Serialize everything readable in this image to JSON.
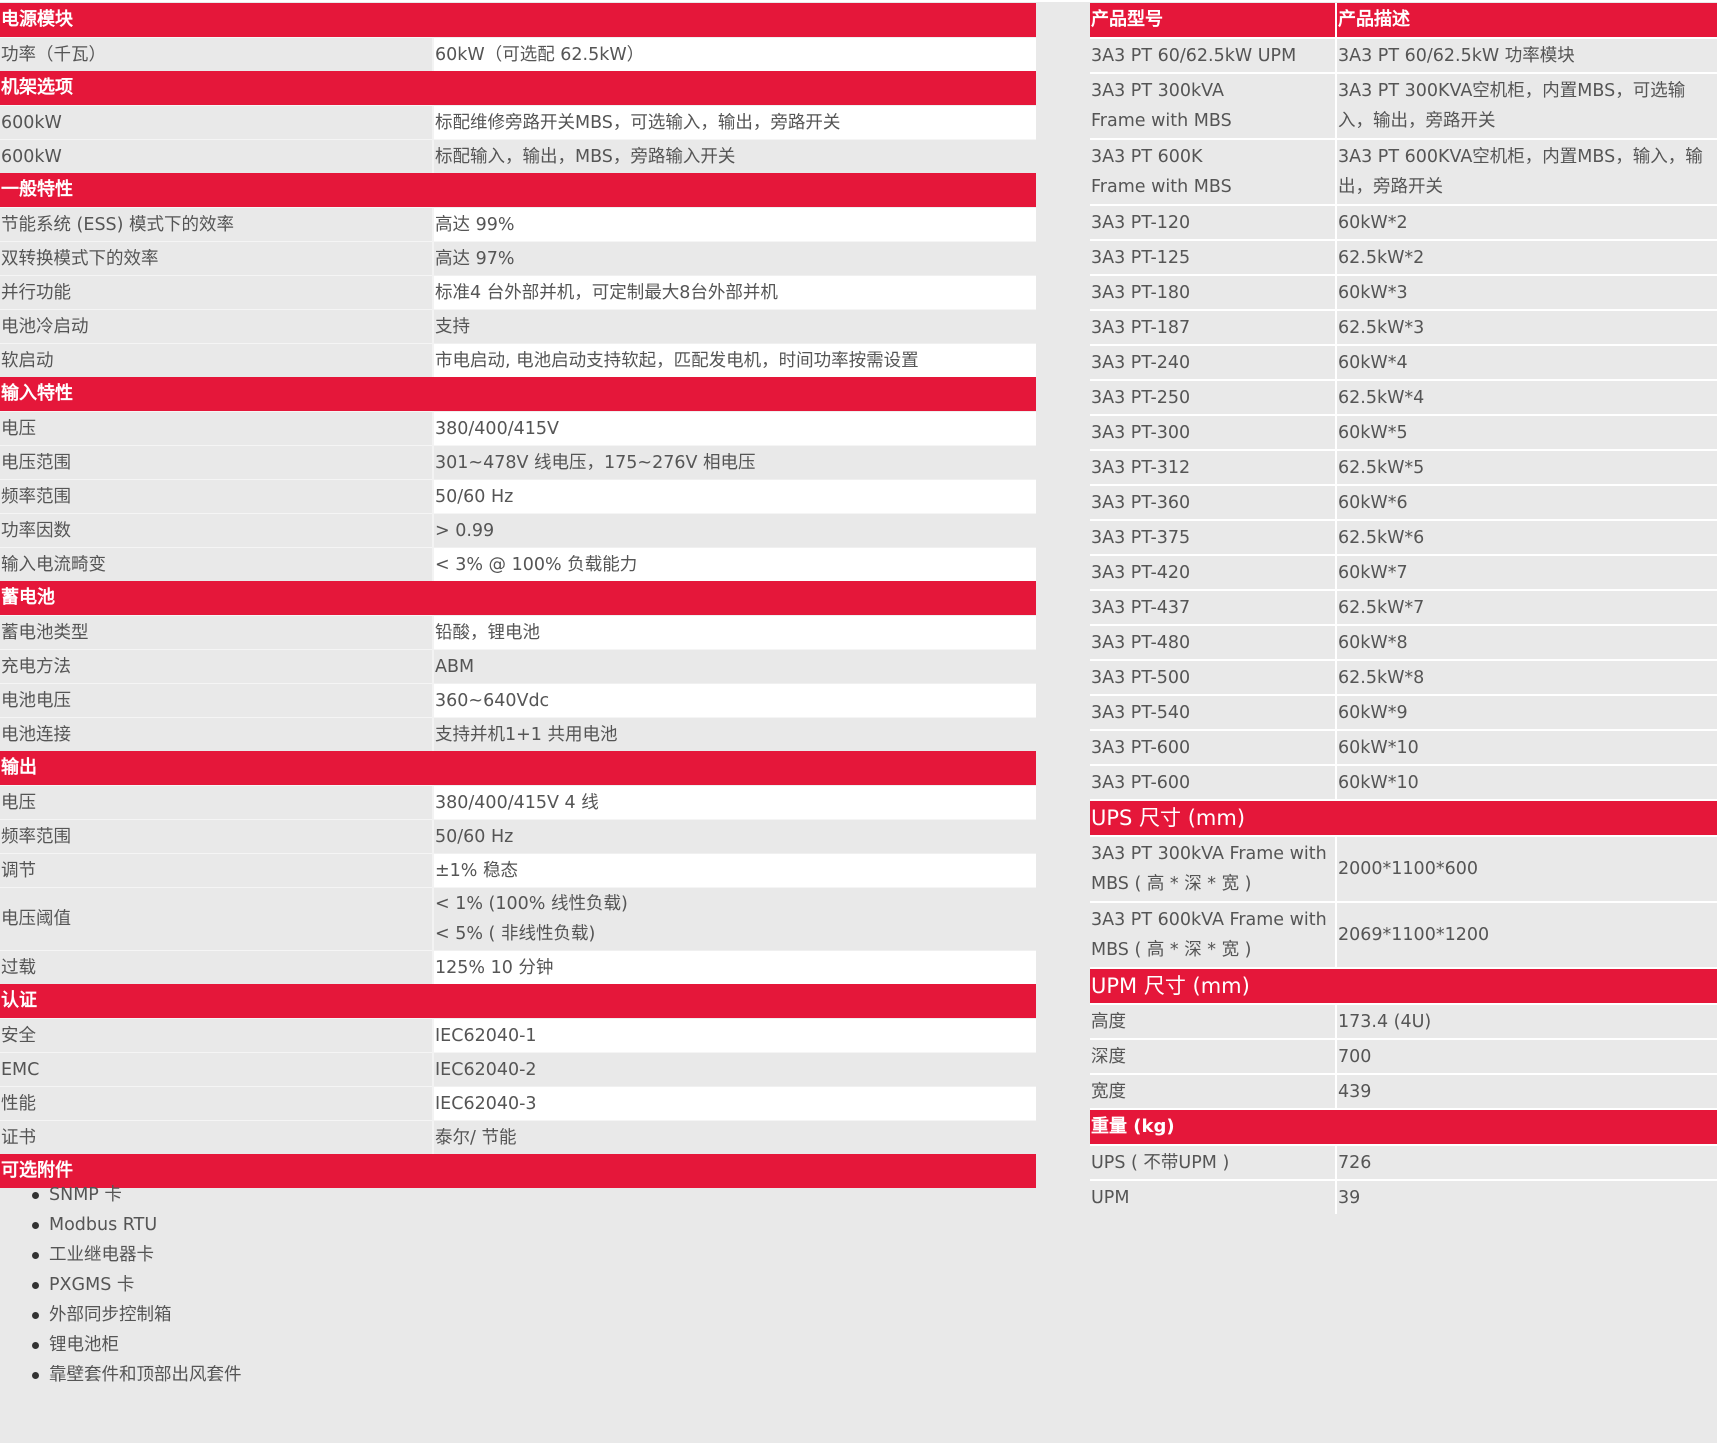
{
  "left_table": [
    {
      "type": "section",
      "label": "电源模块"
    },
    {
      "type": "row",
      "k": "功率（千瓦）",
      "v": "60kW（可选配 62.5kW）"
    },
    {
      "type": "section",
      "label": "机架选项"
    },
    {
      "type": "row",
      "k": "600kW",
      "v": "标配维修旁路开关MBS，可选输入，输出，旁路开关"
    },
    {
      "type": "row",
      "k": "600kW",
      "v": "标配输入，输出，MBS，旁路输入开关",
      "alt": true
    },
    {
      "type": "section",
      "label": "一般特性"
    },
    {
      "type": "row",
      "k": "节能系统 (ESS) 模式下的效率",
      "v": "高达 99%"
    },
    {
      "type": "row",
      "k": "双转换模式下的效率",
      "v": "高达 97%",
      "alt": true
    },
    {
      "type": "row",
      "k": "并行功能",
      "v": "标准4 台外部并机，可定制最大8台外部并机"
    },
    {
      "type": "row",
      "k": "电池冷启动",
      "v": "支持",
      "alt": true
    },
    {
      "type": "row",
      "k": "软启动",
      "v": "市电启动, 电池启动支持软起，匹配发电机，时间功率按需设置"
    },
    {
      "type": "section",
      "label": "输入特性"
    },
    {
      "type": "row",
      "k": "电压",
      "v": "380/400/415V"
    },
    {
      "type": "row",
      "k": "电压范围",
      "v": "301~478V 线电压，175~276V 相电压",
      "alt": true
    },
    {
      "type": "row",
      "k": "频率范围",
      "v": "50/60 Hz"
    },
    {
      "type": "row",
      "k": "功率因数",
      "v": "> 0.99",
      "alt": true
    },
    {
      "type": "row",
      "k": "输入电流畸变",
      "v": "< 3% @ 100% 负载能力"
    },
    {
      "type": "section",
      "label": "蓄电池"
    },
    {
      "type": "row",
      "k": "蓄电池类型",
      "v": "铅酸，锂电池"
    },
    {
      "type": "row",
      "k": "充电方法",
      "v": "ABM",
      "alt": true
    },
    {
      "type": "row",
      "k": "电池电压",
      "v": "360~640Vdc"
    },
    {
      "type": "row",
      "k": "电池连接",
      "v": "支持并机1+1 共用电池",
      "alt": true
    },
    {
      "type": "section",
      "label": "输出"
    },
    {
      "type": "row",
      "k": "电压",
      "v": "380/400/415V  4 线"
    },
    {
      "type": "row",
      "k": "频率范围",
      "v": "50/60 Hz",
      "alt": true
    },
    {
      "type": "row",
      "k": "调节",
      "v": "±1% 稳态"
    },
    {
      "type": "row2",
      "k": "电压阈值",
      "v1": "< 1% (100% 线性负载)",
      "v2": "< 5% ( 非线性负载)",
      "alt": true
    },
    {
      "type": "row",
      "k": "过载",
      "v": "125% 10 分钟"
    },
    {
      "type": "section",
      "label": "认证"
    },
    {
      "type": "row",
      "k": "安全",
      "v": "IEC62040-1"
    },
    {
      "type": "row",
      "k": "EMC",
      "v": "IEC62040-2",
      "alt": true
    },
    {
      "type": "row",
      "k": "性能",
      "v": "IEC62040-3"
    },
    {
      "type": "row",
      "k": "证书",
      "v": "泰尔/ 节能",
      "alt": true
    },
    {
      "type": "section",
      "label": "可选附件"
    }
  ],
  "accessories": [
    "SNMP 卡",
    "Modbus RTU",
    "工业继电器卡",
    "PXGMS 卡",
    "外部同步控制箱",
    "锂电池柜",
    "靠壁套件和顶部出风套件"
  ],
  "right_table": [
    {
      "type": "header",
      "k": "产品型号",
      "v": "产品描述"
    },
    {
      "type": "row",
      "k": "3A3 PT 60/62.5kW UPM",
      "v": "3A3 PT 60/62.5kW 功率模块"
    },
    {
      "type": "row2",
      "k1": "3A3 PT 300kVA",
      "k2": "Frame with MBS",
      "v1": "3A3 PT 300KVA空机柜，内置MBS，可选输",
      "v2": "入，输出，旁路开关"
    },
    {
      "type": "row2",
      "k1": "3A3 PT 600K",
      "k2": "Frame with MBS",
      "v1": "3A3 PT 600KVA空机柜，内置MBS，输入，输",
      "v2": "出，旁路开关"
    },
    {
      "type": "row",
      "k": "3A3 PT-120",
      "v": "60kW*2"
    },
    {
      "type": "row",
      "k": "3A3 PT-125",
      "v": "62.5kW*2"
    },
    {
      "type": "row",
      "k": "3A3 PT-180",
      "v": "60kW*3"
    },
    {
      "type": "row",
      "k": "3A3 PT-187",
      "v": "62.5kW*3"
    },
    {
      "type": "row",
      "k": "3A3 PT-240",
      "v": "60kW*4"
    },
    {
      "type": "row",
      "k": "3A3 PT-250",
      "v": "62.5kW*4"
    },
    {
      "type": "row",
      "k": "3A3 PT-300",
      "v": "60kW*5"
    },
    {
      "type": "row",
      "k": "3A3 PT-312",
      "v": "62.5kW*5"
    },
    {
      "type": "row",
      "k": "3A3 PT-360",
      "v": "60kW*6"
    },
    {
      "type": "row",
      "k": "3A3 PT-375",
      "v": "62.5kW*6"
    },
    {
      "type": "row",
      "k": "3A3 PT-420",
      "v": "60kW*7"
    },
    {
      "type": "row",
      "k": "3A3 PT-437",
      "v": "62.5kW*7"
    },
    {
      "type": "row",
      "k": "3A3 PT-480",
      "v": "60kW*8"
    },
    {
      "type": "row",
      "k": "3A3 PT-500",
      "v": "62.5kW*8"
    },
    {
      "type": "row",
      "k": "3A3 PT-540",
      "v": "60kW*9"
    },
    {
      "type": "row",
      "k": "3A3 PT-600",
      "v": "60kW*10"
    },
    {
      "type": "row",
      "k": "3A3 PT-600",
      "v": "60kW*10"
    },
    {
      "type": "section",
      "label": "UPS 尺寸 (mm)",
      "big": true
    },
    {
      "type": "row2",
      "k1": "3A3 PT 300kVA Frame with",
      "k2": "MBS ( 高 * 深 * 宽 )",
      "v1": "2000*1100*600",
      "v2": ""
    },
    {
      "type": "row2",
      "k1": "3A3 PT 600kVA Frame with",
      "k2": "MBS ( 高 * 深 * 宽 )",
      "v1": "2069*1100*1200",
      "v2": ""
    },
    {
      "type": "section",
      "label": "UPM 尺寸 (mm)",
      "big": true
    },
    {
      "type": "row",
      "k": "高度",
      "v": "173.4 (4U)"
    },
    {
      "type": "row",
      "k": "深度",
      "v": "700"
    },
    {
      "type": "row",
      "k": "宽度",
      "v": "439"
    },
    {
      "type": "section",
      "label": "重量 (kg)"
    },
    {
      "type": "row",
      "k": "UPS ( 不带UPM )",
      "v": "726"
    },
    {
      "type": "row",
      "k": "UPM",
      "v": "39"
    }
  ],
  "colors": {
    "accent": "#e5173a",
    "background": "#e9e9e9",
    "text": "#555555"
  }
}
